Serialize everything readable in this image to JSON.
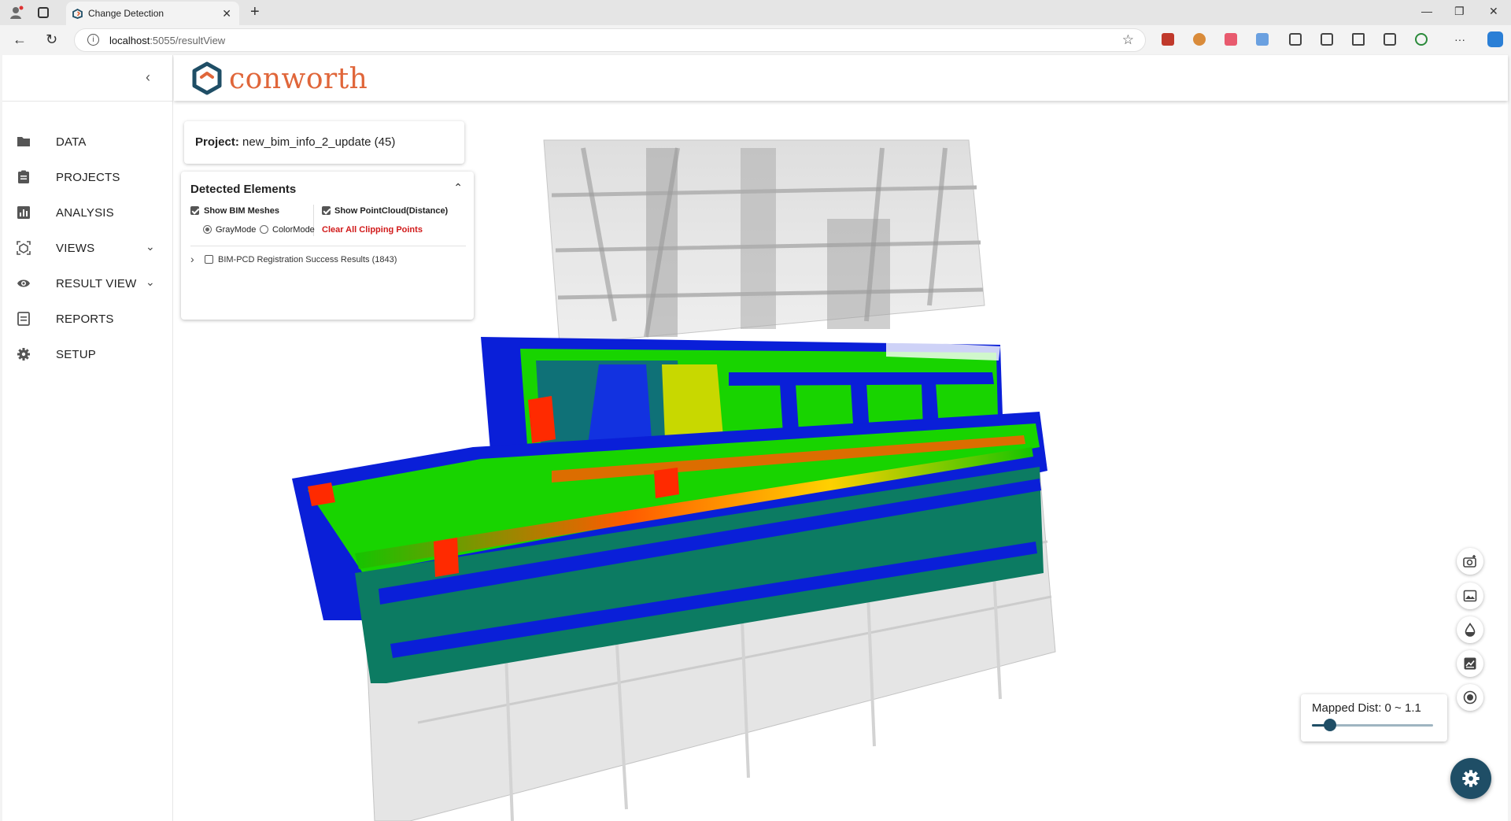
{
  "browser": {
    "tab_title": "Change Detection",
    "address_host": "localhost",
    "address_path": ":5055/resultView",
    "close_glyph": "✕",
    "newtab_glyph": "+",
    "minimize_glyph": "—",
    "restore_glyph": "❐",
    "close_window_glyph": "✕",
    "back_glyph": "←",
    "refresh_glyph": "↻",
    "star_glyph": "☆",
    "info_glyph": "i",
    "more_glyph": "···"
  },
  "sidebar": {
    "collapse_glyph": "‹",
    "items": [
      {
        "label": "DATA",
        "icon": "folder-icon"
      },
      {
        "label": "PROJECTS",
        "icon": "clipboard-icon"
      },
      {
        "label": "ANALYSIS",
        "icon": "bar-chart-icon"
      },
      {
        "label": "VIEWS",
        "icon": "3d-view-icon",
        "expandable": true
      },
      {
        "label": "RESULT VIEW",
        "icon": "eye-icon",
        "expandable": true
      },
      {
        "label": "REPORTS",
        "icon": "report-icon"
      },
      {
        "label": "SETUP",
        "icon": "gear-icon"
      }
    ],
    "chevron_glyph": "⌄"
  },
  "header": {
    "logo_text": "conworth",
    "colors": {
      "brand_teal": "#1f4e66",
      "brand_orange": "#e0663a"
    }
  },
  "project": {
    "label": "Project:",
    "name": "new_bim_info_2_update (45)"
  },
  "detected": {
    "title": "Detected Elements",
    "show_bim": "Show BIM Meshes",
    "show_bim_checked": true,
    "show_pc": "Show PointCloud(Distance)",
    "show_pc_checked": true,
    "gray_mode": "GrayMode",
    "color_mode": "ColorMode",
    "mode_selected": "GrayMode",
    "clear_clipping": "Clear All Clipping Points",
    "tree_item": "BIM-PCD Registration Success Results (1843)",
    "tree_item_checked": false,
    "caret_glyph": "⌃",
    "expand_glyph": "›"
  },
  "mapped_dist": {
    "label": "Mapped Dist: 0 ~ 1.1",
    "slider_fraction": 0.15
  },
  "floating_buttons": [
    "add-camera-icon",
    "image-icon",
    "drop-icon",
    "chart-icon",
    "record-icon"
  ],
  "main_fab": "gear-icon",
  "colors": {
    "accent": "#1f4e66",
    "danger": "#d11a1a"
  }
}
